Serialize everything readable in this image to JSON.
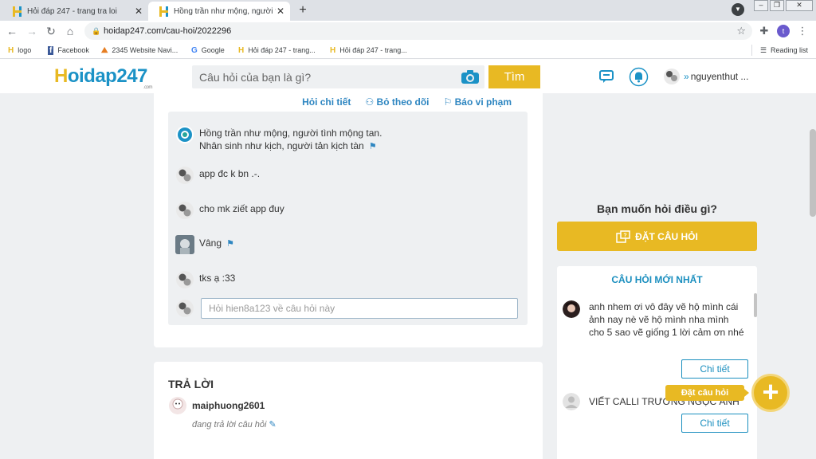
{
  "browser": {
    "tabs": [
      {
        "title": "Hỏi đáp 247 - trang tra loi"
      },
      {
        "title": "Hồng trần như mộng, người tình m"
      }
    ],
    "new_tab": "+",
    "address": "hoidap247.com/cau-hoi/2022296",
    "profile_initial": "t",
    "bookmarks": [
      {
        "label": "logo"
      },
      {
        "label": "Facebook"
      },
      {
        "label": "2345 Website Navi..."
      },
      {
        "label": "Google"
      },
      {
        "label": "Hỏi đáp 247 - trang..."
      },
      {
        "label": "Hỏi đáp 247 - trang..."
      }
    ],
    "reading_list": "Reading list"
  },
  "header": {
    "logo_h": "H",
    "logo_rest": "oidap247",
    "logo_com": ".com",
    "search_placeholder": "Câu hỏi của bạn là gì?",
    "search_button": "Tìm",
    "username": "nguyenthut ..."
  },
  "question": {
    "actions": [
      "Hỏi chi tiết",
      "Bỏ theo dõi",
      "Báo vi phạm"
    ],
    "comments": [
      {
        "text_line1": "Hồng trần như mộng, người tình mộng tan.",
        "text_line2": "Nhân sinh như kịch, người tản kịch tàn"
      },
      {
        "text": "app đc k bn .-."
      },
      {
        "text": "cho mk ziết app đuy"
      },
      {
        "text": "Vâng"
      },
      {
        "text": "tks ạ :33"
      }
    ],
    "reply_placeholder": "Hỏi hien8a123 về câu hỏi này"
  },
  "answer": {
    "title": "TRẢ LỜI",
    "username": "maiphuong2601",
    "status": "đang trả lời câu hỏi"
  },
  "sidebar": {
    "ask_title": "Bạn muốn hỏi điều gì?",
    "ask_button": "ĐẶT CÂU HỎI",
    "new_title": "CÂU HỎI MỚI NHẤT",
    "questions": [
      {
        "text": "anh nhem ơi vô đây vẽ hộ mình cái ảnh nay nè vẽ hộ mình nha mình cho 5 sao vẽ giống 1 lời cảm ơn nhé",
        "button": "Chi tiết"
      },
      {
        "text": "VIẾT CALLI TRƯƠNG NGỌC ÁNH",
        "button": "Chi tiết"
      }
    ]
  },
  "floating": {
    "tip": "Đặt câu hỏi",
    "icon": "+"
  },
  "colors": {
    "brand_blue": "#1b92c6",
    "brand_yellow": "#e8b923",
    "link_blue": "#2e86c1"
  }
}
